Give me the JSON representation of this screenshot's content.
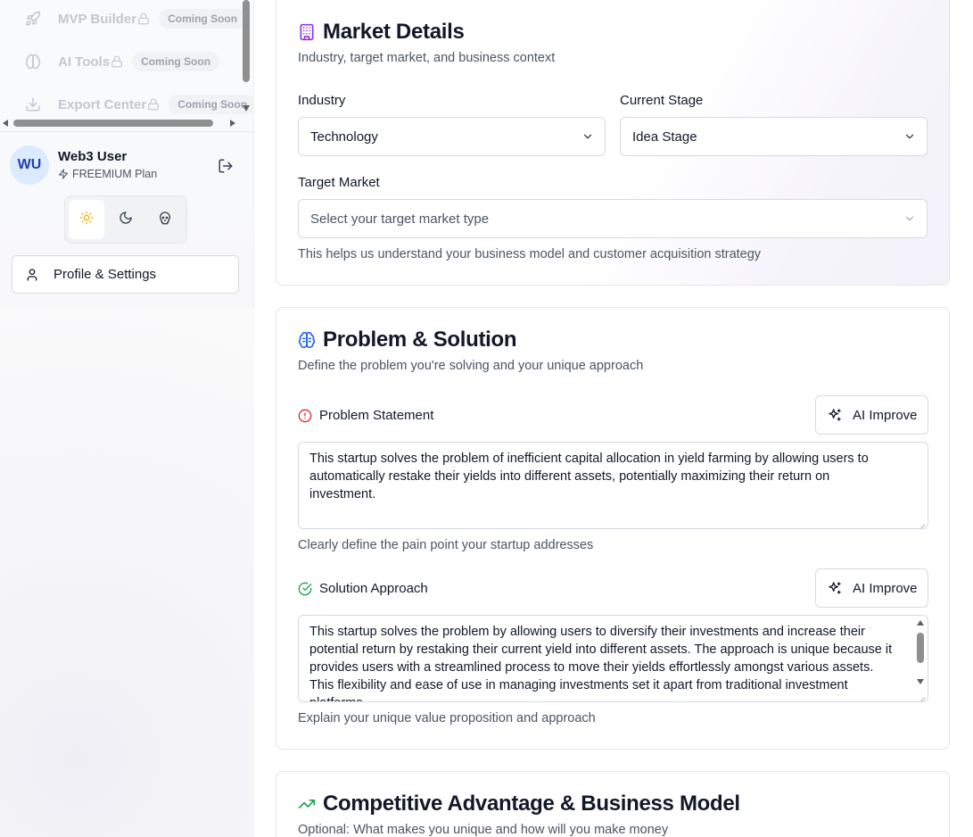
{
  "sidebar": {
    "nav_items": [
      {
        "label": "MVP Builder",
        "badge": "Coming Soon",
        "icon": "rocket-icon"
      },
      {
        "label": "AI Tools",
        "badge": "Coming Soon",
        "icon": "brain-icon"
      },
      {
        "label": "Export Center",
        "badge": "Coming Soon",
        "icon": "download-icon"
      }
    ],
    "user": {
      "initials": "WU",
      "name": "Web3 User",
      "plan": "FREEMIUM Plan"
    },
    "profile_button": "Profile & Settings"
  },
  "market": {
    "title": "Market Details",
    "subtitle": "Industry, target market, and business context",
    "industry_label": "Industry",
    "industry_value": "Technology",
    "stage_label": "Current Stage",
    "stage_value": "Idea Stage",
    "target_label": "Target Market",
    "target_placeholder": "Select your target market type",
    "target_helper": "This helps us understand your business model and customer acquisition strategy"
  },
  "problem": {
    "title": "Problem & Solution",
    "subtitle": "Define the problem you're solving and your unique approach",
    "problem_label": "Problem Statement",
    "ai_improve": "AI Improve",
    "problem_text": "This startup solves the problem of inefficient capital allocation in yield farming by allowing users to automatically restake their yields into different assets, potentially maximizing their return on investment.",
    "problem_helper": "Clearly define the pain point your startup addresses",
    "solution_label": "Solution Approach",
    "solution_text": "This startup solves the problem by allowing users to diversify their investments and increase their potential return by restaking their current yield into different assets. The approach is unique because it provides users with a streamlined process to move their yields effortlessly amongst various assets. This flexibility and ease of use in managing investments set it apart from traditional investment platforms.",
    "solution_helper": "Explain your unique value proposition and approach"
  },
  "competitive": {
    "title": "Competitive Advantage & Business Model",
    "subtitle": "Optional: What makes you unique and how will you make money"
  },
  "colors": {
    "market_icon": "#9333ea",
    "problem_icon": "#2563eb",
    "problem_alert": "#dc2626",
    "solution_check": "#16a34a",
    "competitive_icon": "#16a34a",
    "sun_icon": "#eab308",
    "avatar_bg": "#dbeafe"
  }
}
